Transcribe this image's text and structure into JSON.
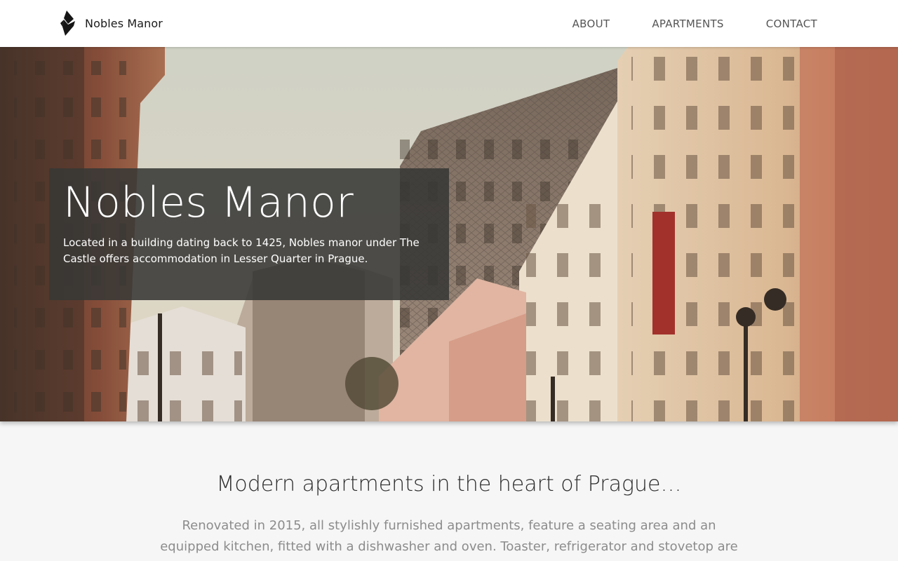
{
  "header": {
    "brand_name": "Nobles Manor",
    "nav": [
      {
        "label": "ABOUT"
      },
      {
        "label": "APARTMENTS"
      },
      {
        "label": "CONTACT"
      }
    ]
  },
  "hero": {
    "title": "Nobles Manor",
    "description": "Located in a building dating back to 1425, Nobles manor under The Castle offers accommodation in Lesser Quarter in Prague."
  },
  "intro": {
    "heading": "Modern apartments in the heart of Prague…",
    "text": "Renovated in 2015, all stylishly furnished apartments, feature a seating area and an equipped kitchen, fitted with a dishwasher and oven. Toaster, refrigerator and stovetop are also featured, as"
  },
  "colors": {
    "header_bg": "#ffffff",
    "page_bg": "#f6f6f6",
    "hero_card_bg": "#383836",
    "nav_text": "#555555",
    "body_text": "#8c8c8c"
  },
  "icons": {
    "brand": "diamond-logo-icon"
  }
}
